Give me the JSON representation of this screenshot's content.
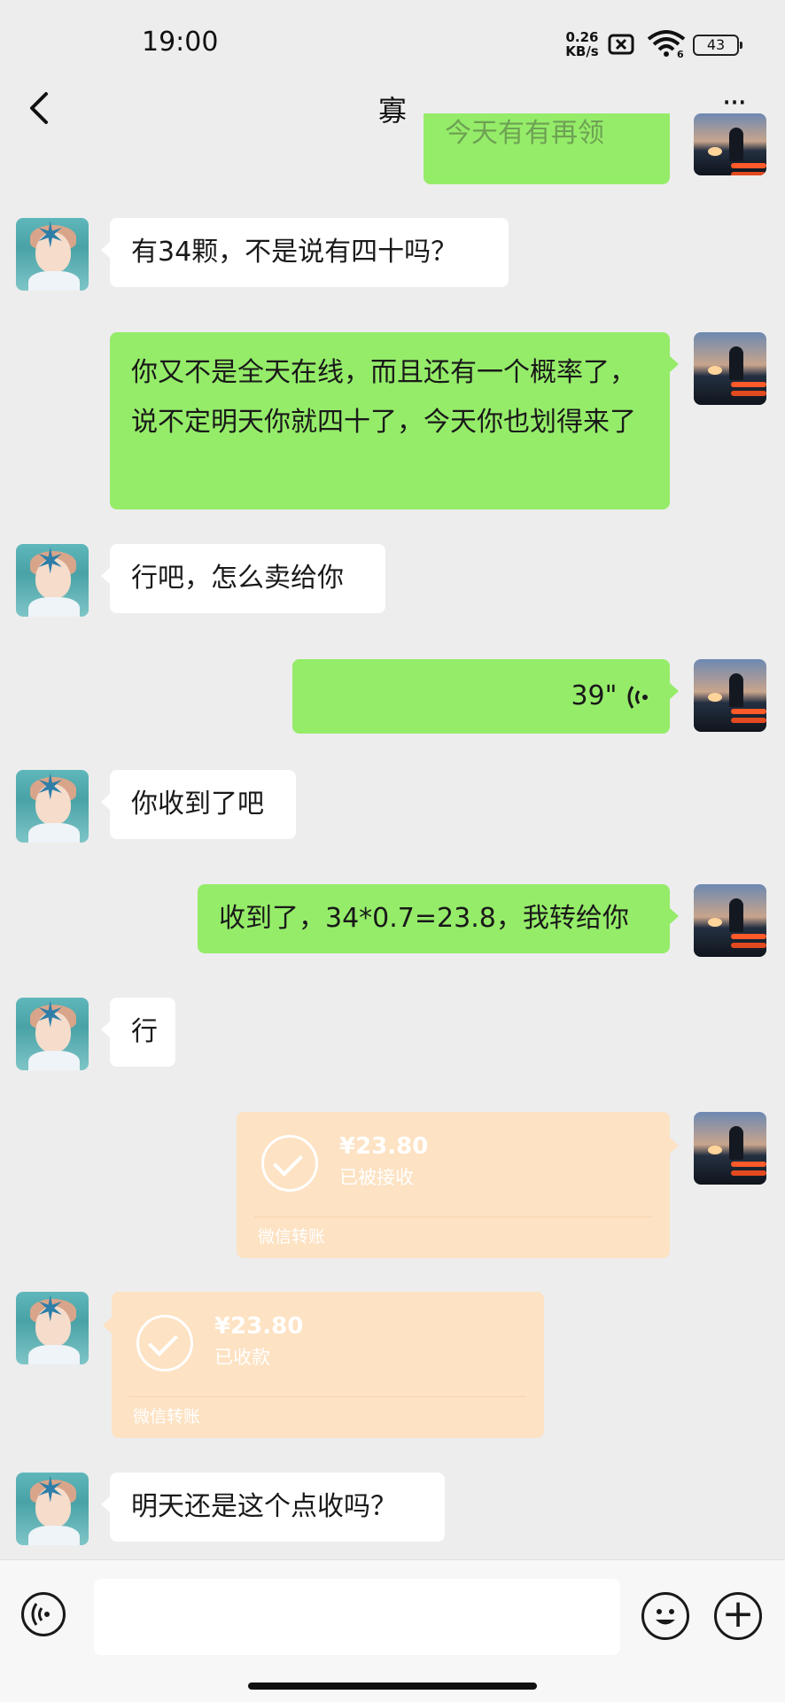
{
  "status_bar": {
    "time": "19:00",
    "net_speed_value": "0.26",
    "net_speed_unit": "KB/s",
    "wifi_label": "6",
    "battery": "43"
  },
  "header": {
    "title": "寡",
    "back_icon": "chevron-left-icon",
    "more_icon": "more-dots-icon",
    "more_label": "···"
  },
  "messages": [
    {
      "side": "right",
      "type": "text",
      "text": "今天有有再领",
      "partial": true
    },
    {
      "side": "left",
      "type": "text",
      "text": "有34颗，不是说有四十吗？"
    },
    {
      "side": "right",
      "type": "text",
      "text": "你又不是全天在线，而且还有一个概率了，说不定明天你就四十了，今天你也划得来了"
    },
    {
      "side": "left",
      "type": "text",
      "text": "行吧，怎么卖给你"
    },
    {
      "side": "right",
      "type": "voice",
      "duration": "39\""
    },
    {
      "side": "left",
      "type": "text",
      "text": "你收到了吧"
    },
    {
      "side": "right",
      "type": "text",
      "text": "收到了，34*0.7=23.8，我转给你"
    },
    {
      "side": "left",
      "type": "text",
      "text": "行"
    },
    {
      "side": "right",
      "type": "transfer",
      "amount": "¥23.80",
      "status": "已被接收",
      "label": "微信转账"
    },
    {
      "side": "left",
      "type": "transfer",
      "amount": "¥23.80",
      "status": "已收款",
      "label": "微信转账"
    },
    {
      "side": "left",
      "type": "text",
      "text": "明天还是这个点收吗？"
    }
  ],
  "input_bar": {
    "placeholder": "",
    "voice_icon": "voice-icon",
    "emoji_icon": "emoji-icon",
    "plus_icon": "plus-icon",
    "plus_label": "+"
  },
  "colors": {
    "background": "#ededed",
    "sent_bubble": "#95ec69",
    "received_bubble": "#ffffff",
    "transfer_card": "#fde2c3"
  }
}
